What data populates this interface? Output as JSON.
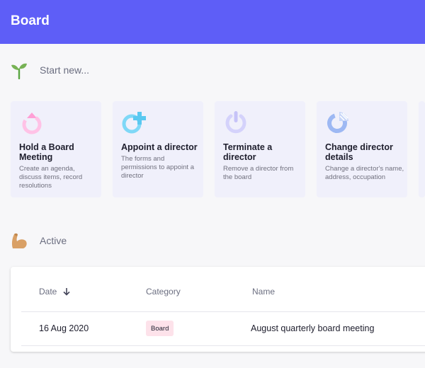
{
  "header": {
    "title": "Board"
  },
  "start_section": {
    "label": "Start new..."
  },
  "cards": [
    {
      "title": "Hold a Board Meeting",
      "desc": "Create an agenda, discuss items, record resolutions"
    },
    {
      "title": "Appoint a director",
      "desc": "The forms and permissions to appoint a director"
    },
    {
      "title": "Terminate a director",
      "desc": "Remove a director from the board"
    },
    {
      "title": "Change director details",
      "desc": "Change a director's name, address, occupation"
    }
  ],
  "active_section": {
    "label": "Active"
  },
  "table": {
    "columns": [
      "Date",
      "Category",
      "Name"
    ],
    "rows": [
      {
        "date": "16 Aug 2020",
        "category": "Board",
        "name": "August quarterly board meeting"
      }
    ]
  },
  "colors": {
    "header_bg": "#5e5ef7",
    "card_bg": "#f0f0fb",
    "badge_bg": "#fde2ea"
  }
}
